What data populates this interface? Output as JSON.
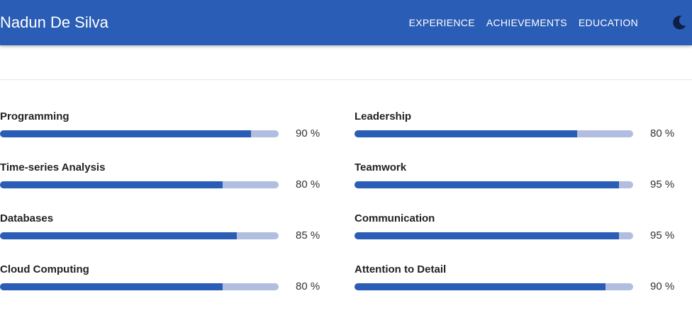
{
  "header": {
    "brand": "Nadun De Silva",
    "nav": [
      {
        "label": "EXPERIENCE"
      },
      {
        "label": "ACHIEVEMENTS"
      },
      {
        "label": "EDUCATION"
      }
    ],
    "theme_icon": "moon-icon"
  },
  "colors": {
    "primary": "#2a5db5",
    "track": "#b1bee0"
  },
  "skills": {
    "left": [
      {
        "label": "Programming",
        "value": 90,
        "value_text": "90 %"
      },
      {
        "label": "Time-series Analysis",
        "value": 80,
        "value_text": "80 %"
      },
      {
        "label": "Databases",
        "value": 85,
        "value_text": "85 %"
      },
      {
        "label": "Cloud Computing",
        "value": 80,
        "value_text": "80 %"
      }
    ],
    "right": [
      {
        "label": "Leadership",
        "value": 80,
        "value_text": "80 %"
      },
      {
        "label": "Teamwork",
        "value": 95,
        "value_text": "95 %"
      },
      {
        "label": "Communication",
        "value": 95,
        "value_text": "95 %"
      },
      {
        "label": "Attention to Detail",
        "value": 90,
        "value_text": "90 %"
      }
    ]
  }
}
